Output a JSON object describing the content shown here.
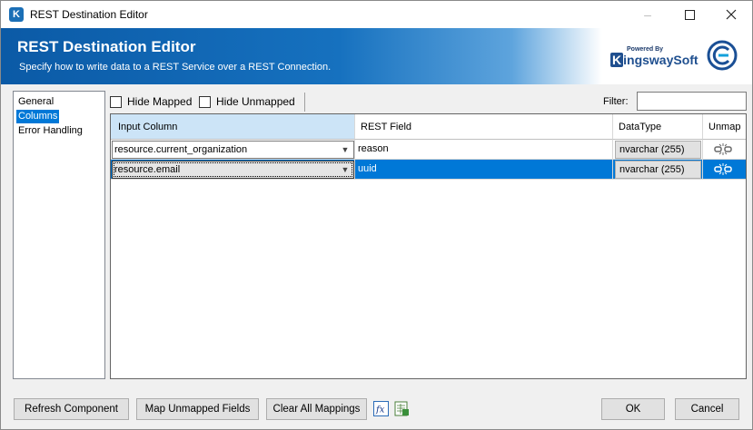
{
  "window": {
    "title": "REST Destination Editor",
    "app_icon_letter": "K"
  },
  "banner": {
    "title": "REST Destination Editor",
    "subtitle": "Specify how to write data to a REST Service over a REST Connection.",
    "brand_powered_by": "Powered By",
    "brand_initial": "K",
    "brand_name_rest": "ingswaySoft"
  },
  "nav": {
    "items": [
      {
        "label": "General",
        "selected": false
      },
      {
        "label": "Columns",
        "selected": true
      },
      {
        "label": "Error Handling",
        "selected": false
      }
    ]
  },
  "toolbar": {
    "hide_mapped_label": "Hide Mapped",
    "hide_mapped_checked": false,
    "hide_unmapped_label": "Hide Unmapped",
    "hide_unmapped_checked": false,
    "filter_label": "Filter:",
    "filter_value": ""
  },
  "grid": {
    "columns": [
      "Input Column",
      "REST Field",
      "DataType",
      "Unmap"
    ],
    "rows": [
      {
        "input": "resource.current_organization",
        "field": "reason",
        "datatype": "nvarchar (255)",
        "selected": false
      },
      {
        "input": "resource.email",
        "field": "uuid",
        "datatype": "nvarchar (255)",
        "selected": true
      }
    ]
  },
  "buttons": {
    "refresh": "Refresh Component",
    "map_unmapped": "Map Unmapped Fields",
    "clear_all": "Clear All Mappings",
    "ok": "OK",
    "cancel": "Cancel"
  },
  "icons": {
    "minimize": "minimize-icon",
    "maximize": "maximize-icon",
    "close": "close-icon",
    "dropdown": "chevron-down-icon",
    "unmap": "unlink-icon",
    "expression": "fx-icon",
    "export": "spreadsheet-icon"
  },
  "colors": {
    "accent": "#0078d7",
    "banner": "#0b5aa6",
    "header_sorted": "#cce4f7"
  }
}
